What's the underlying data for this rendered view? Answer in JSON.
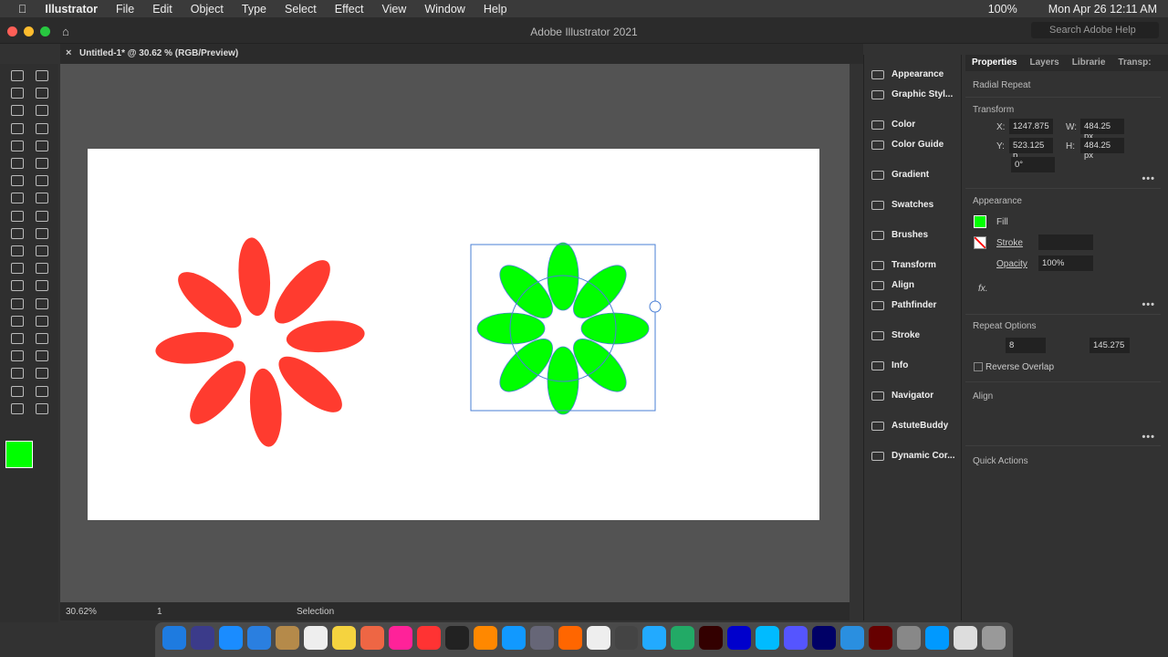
{
  "menubar": {
    "app": "Illustrator",
    "items": [
      "File",
      "Edit",
      "Object",
      "Type",
      "Select",
      "Effect",
      "View",
      "Window",
      "Help"
    ],
    "battery": "100%",
    "clock": "Mon Apr 26  12:11 AM"
  },
  "titlebar": {
    "title": "Adobe Illustrator 2021",
    "search_placeholder": "Search Adobe Help"
  },
  "document": {
    "tab": "Untitled-1* @ 30.62 % (RGB/Preview)"
  },
  "status": {
    "zoom": "30.62%",
    "artboard": "1",
    "tool": "Selection"
  },
  "colors": {
    "fill": "#00ff00",
    "red": "#ff3b2f",
    "selection": "#4a7fd6"
  },
  "panels": [
    "Appearance",
    "Graphic Styl...",
    "Color",
    "Color Guide",
    "Gradient",
    "Swatches",
    "Brushes",
    "Transform",
    "Align",
    "Pathfinder",
    "Stroke",
    "Info",
    "Navigator",
    "AstuteBuddy",
    "Dynamic Cor..."
  ],
  "properties": {
    "tabs": [
      "Properties",
      "Layers",
      "Librarie",
      "Transp:"
    ],
    "object": "Radial Repeat",
    "transform": {
      "title": "Transform",
      "x_label": "X:",
      "x": "1247.875",
      "y_label": "Y:",
      "y": "523.125 p",
      "w_label": "W:",
      "w": "484.25 px",
      "h_label": "H:",
      "h": "484.25 px",
      "angle": "0°"
    },
    "appearance": {
      "title": "Appearance",
      "fill": "Fill",
      "stroke": "Stroke",
      "opacity_label": "Opacity",
      "opacity": "100%",
      "fx": "fx."
    },
    "repeat": {
      "title": "Repeat Options",
      "instances": "8",
      "radius": "145.275",
      "reverse": "Reverse Overlap"
    },
    "align": {
      "title": "Align"
    },
    "quick": {
      "title": "Quick Actions"
    }
  }
}
